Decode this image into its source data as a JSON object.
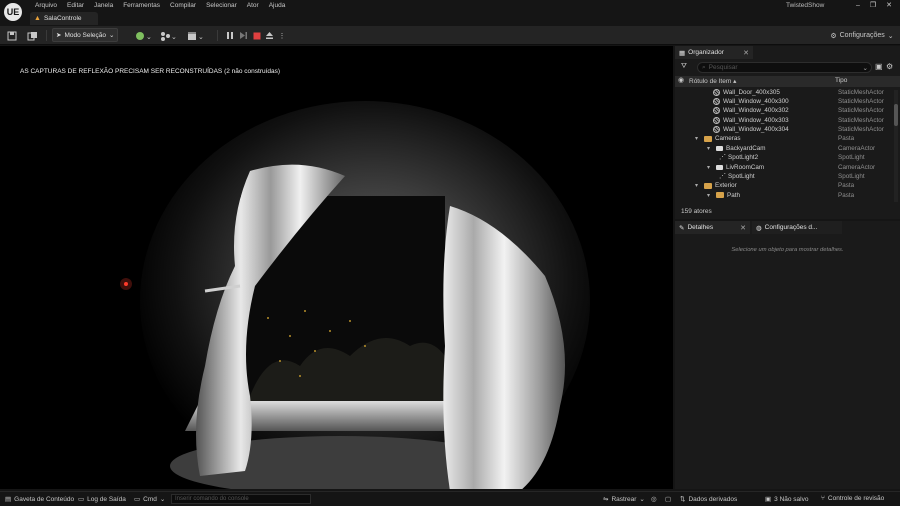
{
  "app": {
    "logo": "UE",
    "name": "TwistedShow",
    "level_tab": "SalaControle",
    "window_controls": [
      "–",
      "❐",
      "✕"
    ]
  },
  "menu": [
    "Arquivo",
    "Editar",
    "Janela",
    "Ferramentas",
    "Compilar",
    "Selecionar",
    "Ator",
    "Ajuda"
  ],
  "toolbar": {
    "mode_label": "Modo Seleção",
    "settings_label": "Configurações"
  },
  "viewport": {
    "warning": "AS CAPTURAS DE REFLEXÃO PRECISAM SER RECONSTRUÍDAS (2 não construídas)"
  },
  "outliner": {
    "tab_label": "Organizador",
    "search_placeholder": "Pesquisar",
    "col_label": "Rótulo de Item",
    "col_type": "Tipo",
    "rows": [
      {
        "label": "Wall_Door_400x305",
        "type": "StaticMeshActor",
        "icon": "mesh-icon"
      },
      {
        "label": "Wall_Window_400x300",
        "type": "StaticMeshActor",
        "icon": "mesh-icon"
      },
      {
        "label": "Wall_Window_400x302",
        "type": "StaticMeshActor",
        "icon": "mesh-icon"
      },
      {
        "label": "Wall_Window_400x303",
        "type": "StaticMeshActor",
        "icon": "mesh-icon"
      },
      {
        "label": "Wall_Window_400x304",
        "type": "StaticMeshActor",
        "icon": "mesh-icon"
      },
      {
        "label": "Cameras",
        "type": "Pasta",
        "icon": "folder-icon"
      },
      {
        "label": "BackyardCam",
        "type": "CameraActor",
        "icon": "camera-icon"
      },
      {
        "label": "SpotLight2",
        "type": "SpotLight",
        "icon": "spotlight-icon"
      },
      {
        "label": "LivRoomCam",
        "type": "CameraActor",
        "icon": "camera-icon"
      },
      {
        "label": "SpotLight",
        "type": "SpotLight",
        "icon": "spotlight-icon"
      },
      {
        "label": "Exterior",
        "type": "Pasta",
        "icon": "folder-icon"
      },
      {
        "label": "Path",
        "type": "Pasta",
        "icon": "folder-icon"
      }
    ],
    "actor_count": "159 atores"
  },
  "details": {
    "tab_label": "Detalhes",
    "tab2_label": "Configurações d...",
    "hint": "Selecione um objeto para mostrar detalhes."
  },
  "statusbar": {
    "content_drawer": "Gaveta de Conteúdo",
    "output_log": "Log de Saída",
    "cmd": "Cmd",
    "cmd_placeholder": "Inserir comando do console",
    "trace": "Rastrear",
    "derived_data": "Dados derivados",
    "unsaved": "3 Não salvo",
    "revision_control": "Controle de revisão"
  },
  "colors": {
    "accent_folder": "#d6a24a",
    "stop_button": "#e04040",
    "background": "#151515"
  }
}
